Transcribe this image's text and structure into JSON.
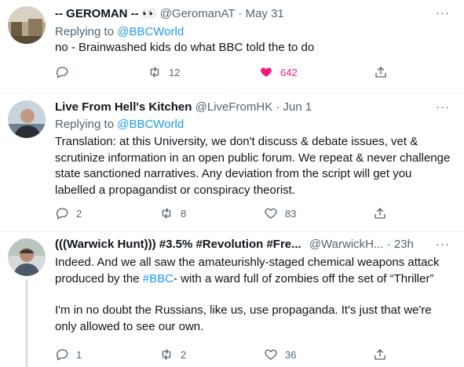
{
  "tweets": [
    {
      "name": "-- GEROMAN --",
      "emoji": "👀",
      "handle": "@GeromanAT",
      "date": "May 31",
      "reply_prefix": "Replying to",
      "reply_to": "@BBCWorld",
      "text": "no - Brainwashed kids do what BBC told the to do",
      "stats": {
        "replies": "",
        "retweets": "12",
        "likes": "642"
      },
      "liked": true
    },
    {
      "name": "Live From Hell's Kitchen",
      "handle": "@LiveFromHK",
      "date": "Jun 1",
      "reply_prefix": "Replying to",
      "reply_to": "@BBCWorld",
      "text": "Translation: at this University, we don't discuss & debate issues, vet & scrutinize information in an open public forum. We repeat & never challenge state sanctioned narratives. Any deviation from the script will get you labelled a propagandist or conspiracy theorist.",
      "stats": {
        "replies": "2",
        "retweets": "8",
        "likes": "83"
      },
      "liked": false
    },
    {
      "name": "(((Warwick Hunt))) #3.5% #Revolution #Fre...",
      "handle": "@WarwickH...",
      "date": "23h",
      "text_a1": "Indeed. And we all saw the amateurishly-staged chemical weapons attack produced by the ",
      "text_link": "#BBC",
      "text_a2": "- with a ward full of zombies off the set of “Thriller”",
      "text_b": "I'm in no doubt the Russians, like us, use propaganda. It's just that we're only allowed to see our own.",
      "stats": {
        "replies": "1",
        "retweets": "2",
        "likes": "36"
      },
      "liked": false
    }
  ],
  "icons": {
    "more": "more-icon",
    "reply": "reply-icon",
    "retweet": "retweet-icon",
    "like": "heart-icon",
    "share": "share-icon"
  },
  "colors": {
    "link": "#1d9bf0",
    "like_active": "#f91880",
    "muted": "#536471"
  }
}
